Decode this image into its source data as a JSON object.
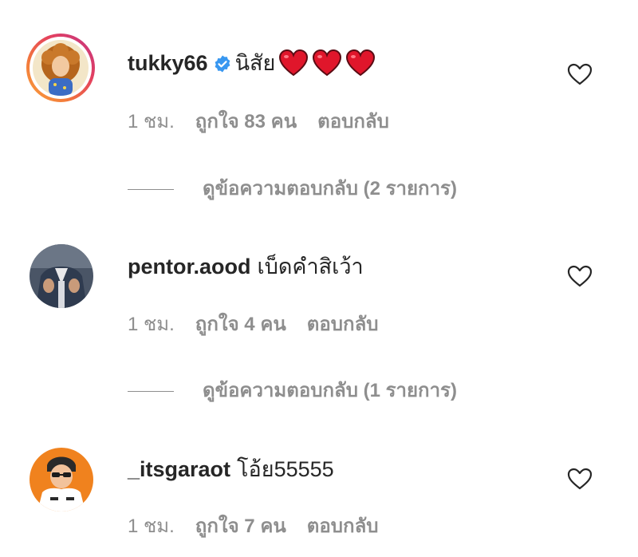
{
  "colors": {
    "text": "#262626",
    "secondary": "#8e8e8e",
    "verified": "#3897f0",
    "heart": "#e0162b"
  },
  "comments": [
    {
      "username": "tukky66",
      "verified": true,
      "text": "นิสัย",
      "emoji": [
        "red-heart-emoji",
        "red-heart-emoji",
        "red-heart-emoji"
      ],
      "time": "1 ชม.",
      "likes": "ถูกใจ 83 คน",
      "reply": "ตอบกลับ",
      "view_replies": "ดูข้อความตอบกลับ (2 รายการ)",
      "like_icon": "heart-outline-icon"
    },
    {
      "username": "pentor.aood",
      "verified": false,
      "text": "เบ็ดคำสิเว้า",
      "time": "1 ชม.",
      "likes": "ถูกใจ 4 คน",
      "reply": "ตอบกลับ",
      "view_replies": "ดูข้อความตอบกลับ (1 รายการ)",
      "like_icon": "heart-outline-icon"
    },
    {
      "username": "_itsgaraot",
      "verified": false,
      "text": "โอ้ย55555",
      "time": "1 ชม.",
      "likes": "ถูกใจ 7 คน",
      "reply": "ตอบกลับ",
      "like_icon": "heart-outline-icon"
    }
  ]
}
